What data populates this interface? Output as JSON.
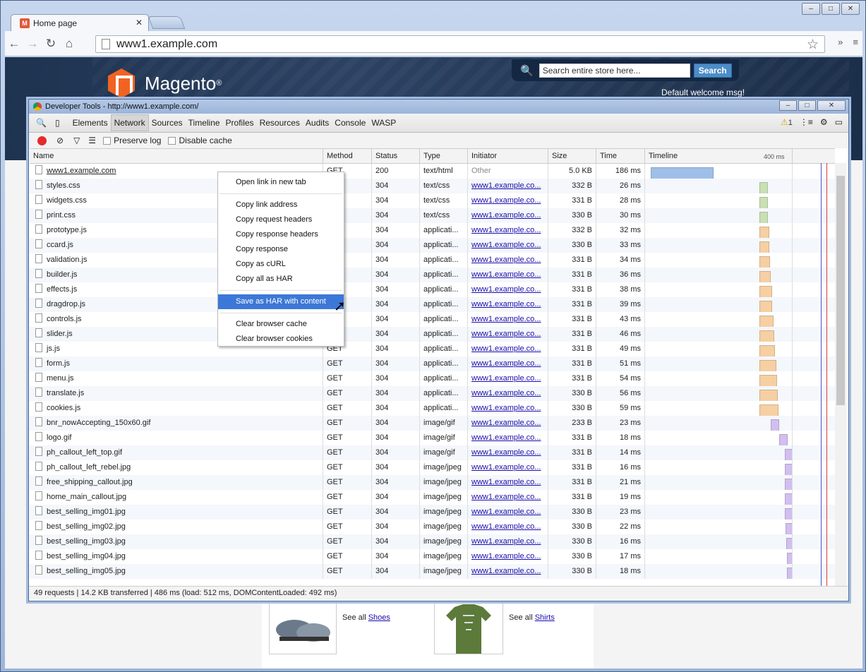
{
  "browser": {
    "tab_title": "Home page",
    "url": "www1.example.com",
    "window_controls": [
      "–",
      "□",
      "✕"
    ]
  },
  "site": {
    "brand": "Magento",
    "search_placeholder": "Search entire store here...",
    "search_button": "Search",
    "welcome": "Default welcome msg!",
    "see_all_prefix": "See all",
    "link_shoes": "Shoes",
    "link_shirts": "Shirts"
  },
  "devtools": {
    "title": "Developer Tools - http://www1.example.com/",
    "panels": [
      "Elements",
      "Network",
      "Sources",
      "Timeline",
      "Profiles",
      "Resources",
      "Audits",
      "Console",
      "WASP"
    ],
    "selected_panel": "Network",
    "warning_count": "1",
    "preserve_log": "Preserve log",
    "disable_cache": "Disable cache",
    "columns": [
      "Name",
      "Method",
      "Status",
      "Type",
      "Initiator",
      "Size",
      "Time",
      "Timeline"
    ],
    "timeline_tick": "400 ms",
    "rows": [
      {
        "name": "www1.example.com",
        "method": "GET",
        "status": "200",
        "type": "text/html",
        "initiator": "Other",
        "size": "5.0 KB",
        "time": "186 ms",
        "bar": "blue",
        "start": 0.0,
        "dur": 0.37
      },
      {
        "name": "styles.css",
        "method": "GET",
        "status": "304",
        "type": "text/css",
        "initiator": "www1.example.co...",
        "size": "332 B",
        "time": "26 ms",
        "bar": "green",
        "start": 0.64,
        "dur": 0.05
      },
      {
        "name": "widgets.css",
        "method": "GET",
        "status": "304",
        "type": "text/css",
        "initiator": "www1.example.co...",
        "size": "331 B",
        "time": "28 ms",
        "bar": "green",
        "start": 0.64,
        "dur": 0.05
      },
      {
        "name": "print.css",
        "method": "GET",
        "status": "304",
        "type": "text/css",
        "initiator": "www1.example.co...",
        "size": "330 B",
        "time": "30 ms",
        "bar": "green",
        "start": 0.64,
        "dur": 0.05
      },
      {
        "name": "prototype.js",
        "method": "GET",
        "status": "304",
        "type": "applicati...",
        "initiator": "www1.example.co...",
        "size": "332 B",
        "time": "32 ms",
        "bar": "orange",
        "start": 0.64,
        "dur": 0.06
      },
      {
        "name": "ccard.js",
        "method": "GET",
        "status": "304",
        "type": "applicati...",
        "initiator": "www1.example.co...",
        "size": "330 B",
        "time": "33 ms",
        "bar": "orange",
        "start": 0.64,
        "dur": 0.06
      },
      {
        "name": "validation.js",
        "method": "GET",
        "status": "304",
        "type": "applicati...",
        "initiator": "www1.example.co...",
        "size": "331 B",
        "time": "34 ms",
        "bar": "orange",
        "start": 0.64,
        "dur": 0.065
      },
      {
        "name": "builder.js",
        "method": "GET",
        "status": "304",
        "type": "applicati...",
        "initiator": "www1.example.co...",
        "size": "331 B",
        "time": "36 ms",
        "bar": "orange",
        "start": 0.64,
        "dur": 0.07
      },
      {
        "name": "effects.js",
        "method": "GET",
        "status": "304",
        "type": "applicati...",
        "initiator": "www1.example.co...",
        "size": "331 B",
        "time": "38 ms",
        "bar": "orange",
        "start": 0.64,
        "dur": 0.075
      },
      {
        "name": "dragdrop.js",
        "method": "GET",
        "status": "304",
        "type": "applicati...",
        "initiator": "www1.example.co...",
        "size": "331 B",
        "time": "39 ms",
        "bar": "orange",
        "start": 0.64,
        "dur": 0.075
      },
      {
        "name": "controls.js",
        "method": "GET",
        "status": "304",
        "type": "applicati...",
        "initiator": "www1.example.co...",
        "size": "331 B",
        "time": "43 ms",
        "bar": "orange",
        "start": 0.64,
        "dur": 0.085
      },
      {
        "name": "slider.js",
        "method": "GET",
        "status": "304",
        "type": "applicati...",
        "initiator": "www1.example.co...",
        "size": "331 B",
        "time": "46 ms",
        "bar": "orange",
        "start": 0.64,
        "dur": 0.09
      },
      {
        "name": "js.js",
        "method": "GET",
        "status": "304",
        "type": "applicati...",
        "initiator": "www1.example.co...",
        "size": "331 B",
        "time": "49 ms",
        "bar": "orange",
        "start": 0.64,
        "dur": 0.095
      },
      {
        "name": "form.js",
        "method": "GET",
        "status": "304",
        "type": "applicati...",
        "initiator": "www1.example.co...",
        "size": "331 B",
        "time": "51 ms",
        "bar": "orange",
        "start": 0.64,
        "dur": 0.1
      },
      {
        "name": "menu.js",
        "method": "GET",
        "status": "304",
        "type": "applicati...",
        "initiator": "www1.example.co...",
        "size": "331 B",
        "time": "54 ms",
        "bar": "orange",
        "start": 0.64,
        "dur": 0.105
      },
      {
        "name": "translate.js",
        "method": "GET",
        "status": "304",
        "type": "applicati...",
        "initiator": "www1.example.co...",
        "size": "330 B",
        "time": "56 ms",
        "bar": "orange",
        "start": 0.64,
        "dur": 0.11
      },
      {
        "name": "cookies.js",
        "method": "GET",
        "status": "304",
        "type": "applicati...",
        "initiator": "www1.example.co...",
        "size": "330 B",
        "time": "59 ms",
        "bar": "orange",
        "start": 0.64,
        "dur": 0.115
      },
      {
        "name": "bnr_nowAccepting_150x60.gif",
        "method": "GET",
        "status": "304",
        "type": "image/gif",
        "initiator": "www1.example.co...",
        "size": "233 B",
        "time": "23 ms",
        "bar": "purple",
        "start": 0.71,
        "dur": 0.045
      },
      {
        "name": "logo.gif",
        "method": "GET",
        "status": "304",
        "type": "image/gif",
        "initiator": "www1.example.co...",
        "size": "331 B",
        "time": "18 ms",
        "bar": "purple",
        "start": 0.76,
        "dur": 0.035
      },
      {
        "name": "ph_callout_left_top.gif",
        "method": "GET",
        "status": "304",
        "type": "image/gif",
        "initiator": "www1.example.co...",
        "size": "331 B",
        "time": "14 ms",
        "bar": "purple",
        "start": 0.79,
        "dur": 0.03
      },
      {
        "name": "ph_callout_left_rebel.jpg",
        "method": "GET",
        "status": "304",
        "type": "image/jpeg",
        "initiator": "www1.example.co...",
        "size": "331 B",
        "time": "16 ms",
        "bar": "purple",
        "start": 0.79,
        "dur": 0.03
      },
      {
        "name": "free_shipping_callout.jpg",
        "method": "GET",
        "status": "304",
        "type": "image/jpeg",
        "initiator": "www1.example.co...",
        "size": "331 B",
        "time": "21 ms",
        "bar": "purple",
        "start": 0.79,
        "dur": 0.04
      },
      {
        "name": "home_main_callout.jpg",
        "method": "GET",
        "status": "304",
        "type": "image/jpeg",
        "initiator": "www1.example.co...",
        "size": "331 B",
        "time": "19 ms",
        "bar": "purple",
        "start": 0.79,
        "dur": 0.035
      },
      {
        "name": "best_selling_img01.jpg",
        "method": "GET",
        "status": "304",
        "type": "image/jpeg",
        "initiator": "www1.example.co...",
        "size": "330 B",
        "time": "23 ms",
        "bar": "purple",
        "start": 0.79,
        "dur": 0.045
      },
      {
        "name": "best_selling_img02.jpg",
        "method": "GET",
        "status": "304",
        "type": "image/jpeg",
        "initiator": "www1.example.co...",
        "size": "330 B",
        "time": "22 ms",
        "bar": "purple",
        "start": 0.795,
        "dur": 0.045
      },
      {
        "name": "best_selling_img03.jpg",
        "method": "GET",
        "status": "304",
        "type": "image/jpeg",
        "initiator": "www1.example.co...",
        "size": "330 B",
        "time": "16 ms",
        "bar": "purple",
        "start": 0.8,
        "dur": 0.035
      },
      {
        "name": "best_selling_img04.jpg",
        "method": "GET",
        "status": "304",
        "type": "image/jpeg",
        "initiator": "www1.example.co...",
        "size": "330 B",
        "time": "17 ms",
        "bar": "purple",
        "start": 0.805,
        "dur": 0.035
      },
      {
        "name": "best_selling_img05.jpg",
        "method": "GET",
        "status": "304",
        "type": "image/jpeg",
        "initiator": "www1.example.co...",
        "size": "330 B",
        "time": "18 ms",
        "bar": "purple",
        "start": 0.805,
        "dur": 0.04
      }
    ],
    "status_bar": "49 requests | 14.2 KB transferred | 486 ms (load: 512 ms, DOMContentLoaded: 492 ms)",
    "context_menu": [
      "Open link in new tab",
      "---",
      "Copy link address",
      "Copy request headers",
      "Copy response headers",
      "Copy response",
      "Copy as cURL",
      "Copy all as HAR",
      "---",
      "Save as HAR with content",
      "---",
      "Clear browser cache",
      "Clear browser cookies"
    ],
    "context_menu_selected": "Save as HAR with content"
  },
  "colors": {
    "blue": "#9fbfe8",
    "green": "#c9e0b3",
    "orange": "#f6cfa2",
    "purple": "#d2bff0",
    "accent": "#3c78d8"
  }
}
